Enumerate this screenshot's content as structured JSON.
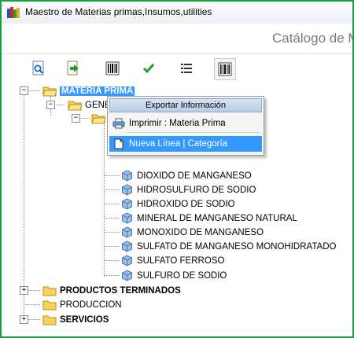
{
  "window": {
    "title": "Maestro de Materias primas,Insumos,utilities",
    "catalog_title": "Catálogo de M"
  },
  "toolbar": {
    "buttons": [
      {
        "name": "search-doc-icon"
      },
      {
        "name": "export-arrow-icon"
      },
      {
        "name": "barcode-icon"
      },
      {
        "name": "checkmark-icon"
      },
      {
        "name": "list-icon"
      },
      {
        "name": "barcode-icon"
      }
    ]
  },
  "tree": {
    "root1": "MATERIA PRIMA",
    "child1": "GENE",
    "items": [
      "DIOXIDO DE MANGANESO",
      "HIDROSULFURO DE SODIO",
      "HIDROXIDO DE SODIO",
      "MINERAL DE MANGANESO NATURAL",
      "MONOXIDO DE MANGANESO",
      "SULFATO DE MANGANESO MONOHIDRATADO",
      "SULFATO FERROSO",
      "SULFURO DE SODIO"
    ],
    "root2": "PRODUCTOS TERMINADOS",
    "root3": "PRODUCCION",
    "root4": "SERVICIOS",
    "collapse_glyph": "−",
    "expand_glyph": "+"
  },
  "context_menu": {
    "header": "Exportar Información",
    "item_print": "Imprimir : Materia Prima",
    "item_new": "Nueva Línea | Categoría"
  },
  "colors": {
    "window_border": "#18a03e",
    "selection": "#3399ff",
    "folder": "#f5d35a"
  }
}
